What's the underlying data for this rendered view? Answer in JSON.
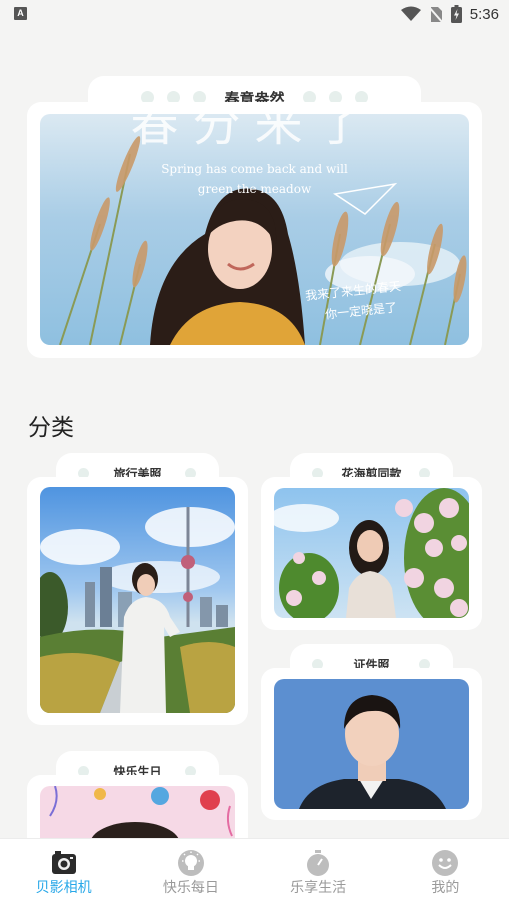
{
  "status_bar": {
    "notification_icon": "A",
    "time": "5:36",
    "icons": [
      "wifi-icon",
      "no-sim-icon",
      "battery-charging-icon"
    ]
  },
  "banner": {
    "title": "春意盎然",
    "overlay_big_text": "春分来了",
    "overlay_en_line1": "Spring has come back and will",
    "overlay_en_line2": "green the meadow",
    "overlay_hand_line1": "我来了来生的春天",
    "overlay_hand_line2": "你一定晓是了"
  },
  "section": {
    "title": "分类"
  },
  "categories": [
    {
      "title": "旅行美照"
    },
    {
      "title": "花海剪同款"
    },
    {
      "title": "证件照"
    },
    {
      "title": "快乐生日"
    }
  ],
  "bottom_nav": {
    "active_color": "#29a8e8",
    "items": [
      {
        "label": "贝影相机",
        "icon": "camera-icon",
        "active": true
      },
      {
        "label": "快乐每日",
        "icon": "lightbulb-icon",
        "active": false
      },
      {
        "label": "乐享生活",
        "icon": "stopwatch-icon",
        "active": false
      },
      {
        "label": "我的",
        "icon": "smiley-icon",
        "active": false
      }
    ]
  }
}
